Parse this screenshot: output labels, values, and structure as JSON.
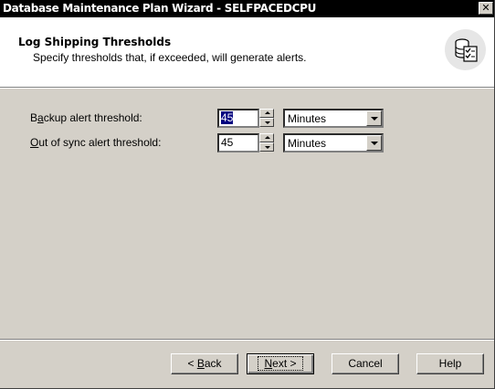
{
  "window": {
    "title": "Database Maintenance Plan Wizard - SELFPACEDCPU",
    "close_glyph": "✕"
  },
  "header": {
    "title": "Log Shipping Thresholds",
    "subtitle": "Specify thresholds that, if exceeded, will generate alerts.",
    "icon": "database-checklist-icon"
  },
  "fields": {
    "backup": {
      "label_pre": "B",
      "label_accel": "a",
      "label_post": "ckup alert threshold:",
      "value": "45",
      "unit": "Minutes"
    },
    "out_of_sync": {
      "label_pre": "",
      "label_accel": "O",
      "label_post": "ut of sync alert threshold:",
      "value": "45",
      "unit": "Minutes"
    }
  },
  "buttons": {
    "back": {
      "pre": "< ",
      "accel": "B",
      "post": "ack"
    },
    "next": {
      "pre": "",
      "accel": "N",
      "post": "ext >"
    },
    "cancel": "Cancel",
    "help": "Help"
  }
}
